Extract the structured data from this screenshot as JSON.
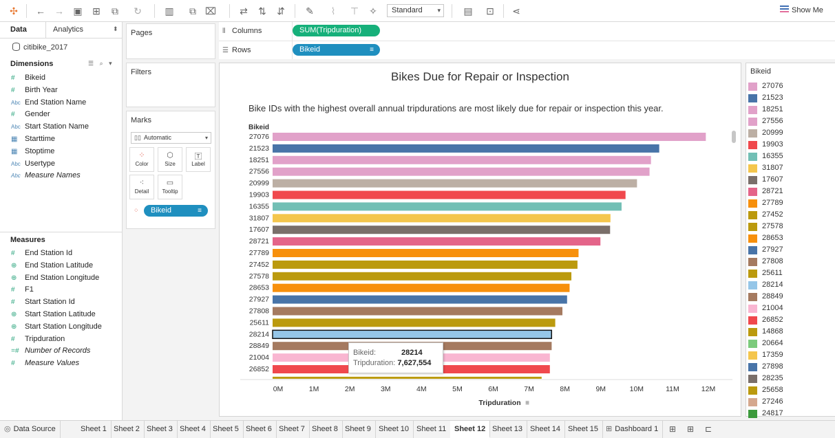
{
  "toolbar": {
    "icons": [
      "tableau-logo-icon",
      "back-icon",
      "forward-icon",
      "save-icon",
      "new-datasource-icon",
      "duplicate-icon",
      "refresh-icon",
      "new-sheet-icon",
      "duplicate-sheet-icon",
      "clear-sheet-icon",
      "swap-icon",
      "sort-ascending-icon",
      "sort-descending-icon",
      "highlight-icon",
      "paperclip-icon",
      "label-icon",
      "pin-icon",
      "fit-icon",
      "presentation-icon",
      "share-icon"
    ],
    "fit_select": "Standard",
    "show_me": "Show Me"
  },
  "datapane": {
    "tab_data": "Data",
    "tab_analytics": "Analytics",
    "datasource": "citibike_2017",
    "dimensions_title": "Dimensions",
    "dimensions": [
      {
        "icon": "#",
        "label": "Bikeid",
        "kind": "meas",
        "italic": false
      },
      {
        "icon": "#",
        "label": "Birth Year",
        "kind": "meas",
        "italic": false
      },
      {
        "icon": "Abc",
        "label": "End Station Name",
        "kind": "abc",
        "italic": false
      },
      {
        "icon": "#",
        "label": "Gender",
        "kind": "meas",
        "italic": false
      },
      {
        "icon": "Abc",
        "label": "Start Station Name",
        "kind": "abc",
        "italic": false
      },
      {
        "icon": "▦",
        "label": "Starttime",
        "kind": "date",
        "italic": false
      },
      {
        "icon": "▦",
        "label": "Stoptime",
        "kind": "date",
        "italic": false
      },
      {
        "icon": "Abc",
        "label": "Usertype",
        "kind": "abc",
        "italic": false
      },
      {
        "icon": "Abc",
        "label": "Measure Names",
        "kind": "abc",
        "italic": true
      }
    ],
    "measures_title": "Measures",
    "measures": [
      {
        "icon": "#",
        "label": "End Station Id",
        "italic": false
      },
      {
        "icon": "⊕",
        "label": "End Station Latitude",
        "italic": false
      },
      {
        "icon": "⊕",
        "label": "End Station Longitude",
        "italic": false
      },
      {
        "icon": "#",
        "label": "F1",
        "italic": false
      },
      {
        "icon": "#",
        "label": "Start Station Id",
        "italic": false
      },
      {
        "icon": "⊕",
        "label": "Start Station Latitude",
        "italic": false
      },
      {
        "icon": "⊕",
        "label": "Start Station Longitude",
        "italic": false
      },
      {
        "icon": "#",
        "label": "Tripduration",
        "italic": false
      },
      {
        "icon": "=#",
        "label": "Number of Records",
        "italic": true
      },
      {
        "icon": "#",
        "label": "Measure Values",
        "italic": true
      }
    ]
  },
  "cards": {
    "pages": "Pages",
    "filters": "Filters",
    "marks": "Marks",
    "mark_type": "Automatic",
    "buttons": {
      "color": "Color",
      "size": "Size",
      "label": "Label",
      "detail": "Detail",
      "tooltip": "Tooltip"
    },
    "color_pill": "Bikeid"
  },
  "shelves": {
    "columns_label": "Columns",
    "columns_pill": "SUM(Tripduration)",
    "rows_label": "Rows",
    "rows_pill": "Bikeid"
  },
  "viz": {
    "title": "Bikes Due for Repair or Inspection",
    "subtitle": "Bike IDs with the highest overall annual tripdurations are most likely due for repair or inspection this year.",
    "row_header": "Bikeid",
    "x_axis_title": "Tripduration",
    "x_ticks": [
      "0M",
      "1M",
      "2M",
      "3M",
      "4M",
      "5M",
      "6M",
      "7M",
      "8M",
      "9M",
      "10M",
      "11M",
      "12M"
    ]
  },
  "legend": {
    "title": "Bikeid",
    "items": [
      {
        "label": "27076",
        "color": "#e1a1c9"
      },
      {
        "label": "21523",
        "color": "#4874a8"
      },
      {
        "label": "18251",
        "color": "#e1a1c9"
      },
      {
        "label": "27556",
        "color": "#e1a1c9"
      },
      {
        "label": "20999",
        "color": "#bcafa4"
      },
      {
        "label": "19903",
        "color": "#f0484d"
      },
      {
        "label": "16355",
        "color": "#72bfb5"
      },
      {
        "label": "31807",
        "color": "#f4c64d"
      },
      {
        "label": "17607",
        "color": "#7a6f6a"
      },
      {
        "label": "28721",
        "color": "#e46489"
      },
      {
        "label": "27789",
        "color": "#f7900c"
      },
      {
        "label": "27452",
        "color": "#bb9a0e"
      },
      {
        "label": "27578",
        "color": "#bb9a0e"
      },
      {
        "label": "28653",
        "color": "#f7900c"
      },
      {
        "label": "27927",
        "color": "#4874a8"
      },
      {
        "label": "27808",
        "color": "#a57a60"
      },
      {
        "label": "25611",
        "color": "#bb9a0e"
      },
      {
        "label": "28214",
        "color": "#95c6e8"
      },
      {
        "label": "28849",
        "color": "#a57a60"
      },
      {
        "label": "21004",
        "color": "#f9b6d1"
      },
      {
        "label": "26852",
        "color": "#f0484d"
      },
      {
        "label": "14868",
        "color": "#bb9a0e"
      },
      {
        "label": "20664",
        "color": "#7ccb7c"
      },
      {
        "label": "17359",
        "color": "#f4c64d"
      },
      {
        "label": "27898",
        "color": "#4874a8"
      },
      {
        "label": "28235",
        "color": "#7a6f6a"
      },
      {
        "label": "25658",
        "color": "#bb9a0e"
      },
      {
        "label": "27246",
        "color": "#d5a88e"
      },
      {
        "label": "24817",
        "color": "#3d9a3d"
      }
    ]
  },
  "tooltip": {
    "k1": "Bikeid:",
    "v1": "28214",
    "k2": "Tripduration:",
    "v2": "7,627,554"
  },
  "tabs": [
    {
      "label": "Data Source",
      "active": false
    },
    {
      "label": "Sheet 1",
      "active": false
    },
    {
      "label": "Sheet 2",
      "active": false
    },
    {
      "label": "Sheet 3",
      "active": false
    },
    {
      "label": "Sheet 4",
      "active": false
    },
    {
      "label": "Sheet 5",
      "active": false
    },
    {
      "label": "Sheet 6",
      "active": false
    },
    {
      "label": "Sheet 7",
      "active": false
    },
    {
      "label": "Sheet 8",
      "active": false
    },
    {
      "label": "Sheet 9",
      "active": false
    },
    {
      "label": "Sheet 10",
      "active": false
    },
    {
      "label": "Sheet 11",
      "active": false
    },
    {
      "label": "Sheet 12",
      "active": true
    },
    {
      "label": "Sheet 13",
      "active": false
    },
    {
      "label": "Sheet 14",
      "active": false
    },
    {
      "label": "Sheet 15",
      "active": false
    },
    {
      "label": "Dashboard 1",
      "active": false
    }
  ],
  "chart_data": {
    "type": "bar",
    "orientation": "horizontal",
    "title": "Bikes Due for Repair or Inspection",
    "xlabel": "Tripduration",
    "ylabel": "Bikeid",
    "xlim": [
      0,
      12000000
    ],
    "categories": [
      "27076",
      "21523",
      "18251",
      "27556",
      "20999",
      "19903",
      "16355",
      "31807",
      "17607",
      "28721",
      "27789",
      "27452",
      "27578",
      "28653",
      "27927",
      "27808",
      "25611",
      "28214",
      "28849",
      "21004",
      "26852"
    ],
    "values": [
      11930000,
      10630000,
      10400000,
      10360000,
      10010000,
      9690000,
      9580000,
      9270000,
      9260000,
      8990000,
      8380000,
      8350000,
      8180000,
      8130000,
      8060000,
      7930000,
      7730000,
      7627554,
      7630000,
      7580000,
      7580000
    ],
    "colors": [
      "#e1a1c9",
      "#4874a8",
      "#e1a1c9",
      "#e1a1c9",
      "#bcafa4",
      "#f0484d",
      "#72bfb5",
      "#f4c64d",
      "#7a6f6a",
      "#e46489",
      "#f7900c",
      "#bb9a0e",
      "#bb9a0e",
      "#f7900c",
      "#4874a8",
      "#a57a60",
      "#bb9a0e",
      "#95c6e8",
      "#a57a60",
      "#f9b6d1",
      "#f0484d"
    ],
    "highlighted": "28214"
  }
}
